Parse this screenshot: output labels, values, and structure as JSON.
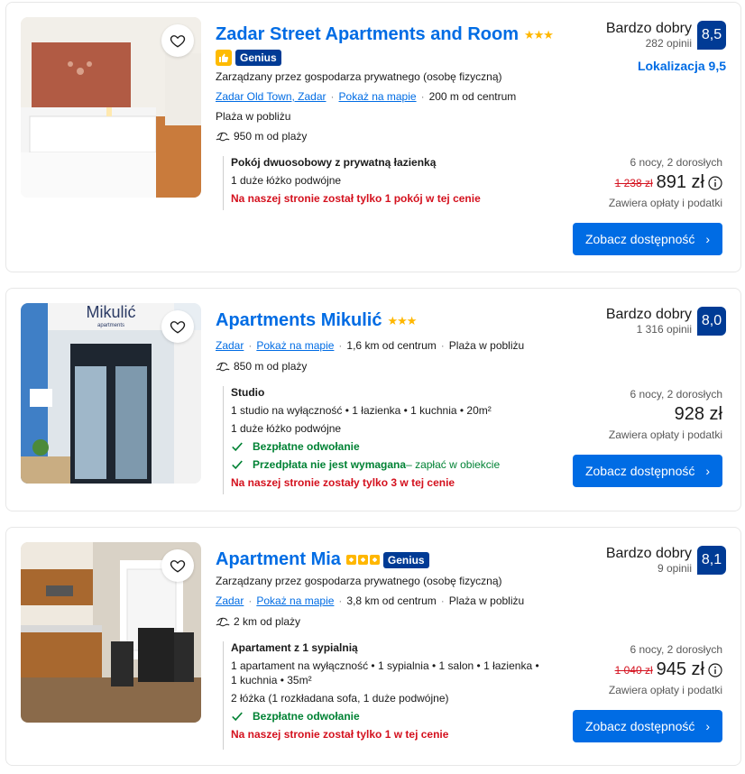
{
  "listings": [
    {
      "name": "Zadar Street Apartments and Room",
      "stars": "★★★",
      "genius": "Genius",
      "managed": "Zarządzany przez gospodarza prywatnego (osobę fizyczną)",
      "location_link": "Zadar Old Town, Zadar",
      "map_link": "Pokaż na mapie",
      "distance_center": "200 m od centrum",
      "beach_note": "Plaża w pobliżu",
      "beach_distance": "950 m od plaży",
      "room_name": "Pokój dwuosobowy z prywatną łazienką",
      "room_details": [
        "1 duże łóżko podwójne"
      ],
      "scarcity": "Na naszej stronie został tylko 1 pokój w tej cenie",
      "score_word": "Bardzo dobry",
      "review_count": "282 opinii",
      "score": "8,5",
      "location_score": "Lokalizacja 9,5",
      "nights": "6 nocy, 2 dorosłych",
      "old_price": "1 238 zł",
      "price": "891 zł",
      "taxes": "Zawiera opłaty i podatki",
      "button": "Zobacz dostępność"
    },
    {
      "name": "Apartments Mikulić",
      "stars": "★★★",
      "location_link": "Zadar",
      "map_link": "Pokaż na mapie",
      "distance_center": "1,6 km od centrum",
      "beach_note": "Plaża w pobliżu",
      "beach_distance": "850 m od plaży",
      "room_name": "Studio",
      "room_details": [
        "1 studio na wyłączność • 1 łazienka • 1 kuchnia • 20m²",
        "1 duże łóżko podwójne"
      ],
      "free_cancel": "Bezpłatne odwołanie",
      "no_prepay": "Przedpłata nie jest wymagana",
      "no_prepay_suffix": " – zapłać w obiekcie",
      "scarcity": "Na naszej stronie zostały tylko 3 w tej cenie",
      "photo_sign": "Mikulić",
      "photo_sign_sub": "apartments",
      "score_word": "Bardzo dobry",
      "review_count": "1 316 opinii",
      "score": "8,0",
      "nights": "6 nocy, 2 dorosłych",
      "price": "928 zł",
      "taxes": "Zawiera opłaty i podatki",
      "button": "Zobacz dostępność"
    },
    {
      "name": "Apartment Mia",
      "genius": "Genius",
      "managed": "Zarządzany przez gospodarza prywatnego (osobę fizyczną)",
      "location_link": "Zadar",
      "map_link": "Pokaż na mapie",
      "distance_center": "3,8 km od centrum",
      "beach_note": "Plaża w pobliżu",
      "beach_distance": "2 km od plaży",
      "room_name": "Apartament z 1 sypialnią",
      "room_details": [
        "1 apartament na wyłączność • 1 sypialnia • 1 salon • 1 łazienka •",
        "1 kuchnia • 35m²",
        "2 łóżka (1 rozkładana sofa, 1 duże podwójne)"
      ],
      "free_cancel": "Bezpłatne odwołanie",
      "scarcity": "Na naszej stronie został tylko 1 w tej cenie",
      "score_word": "Bardzo dobry",
      "review_count": "9 opinii",
      "score": "8,1",
      "nights": "6 nocy, 2 dorosłych",
      "old_price": "1 040 zł",
      "price": "945 zł",
      "taxes": "Zawiera opłaty i podatki",
      "button": "Zobacz dostępność"
    }
  ],
  "icons": {
    "favorite": "heart-icon",
    "beach": "beach-icon",
    "check": "checkmark-icon",
    "info": "info-icon",
    "chevron": "chevron-right-icon",
    "genius_thumb": "thumbs-up-icon"
  },
  "colors": {
    "link_blue": "#006ce4",
    "brand_dark_blue": "#003b95",
    "star_yellow": "#ffb700",
    "genius_yellow": "#febb02",
    "scarcity_red": "#d4111e",
    "success_green": "#008234"
  }
}
